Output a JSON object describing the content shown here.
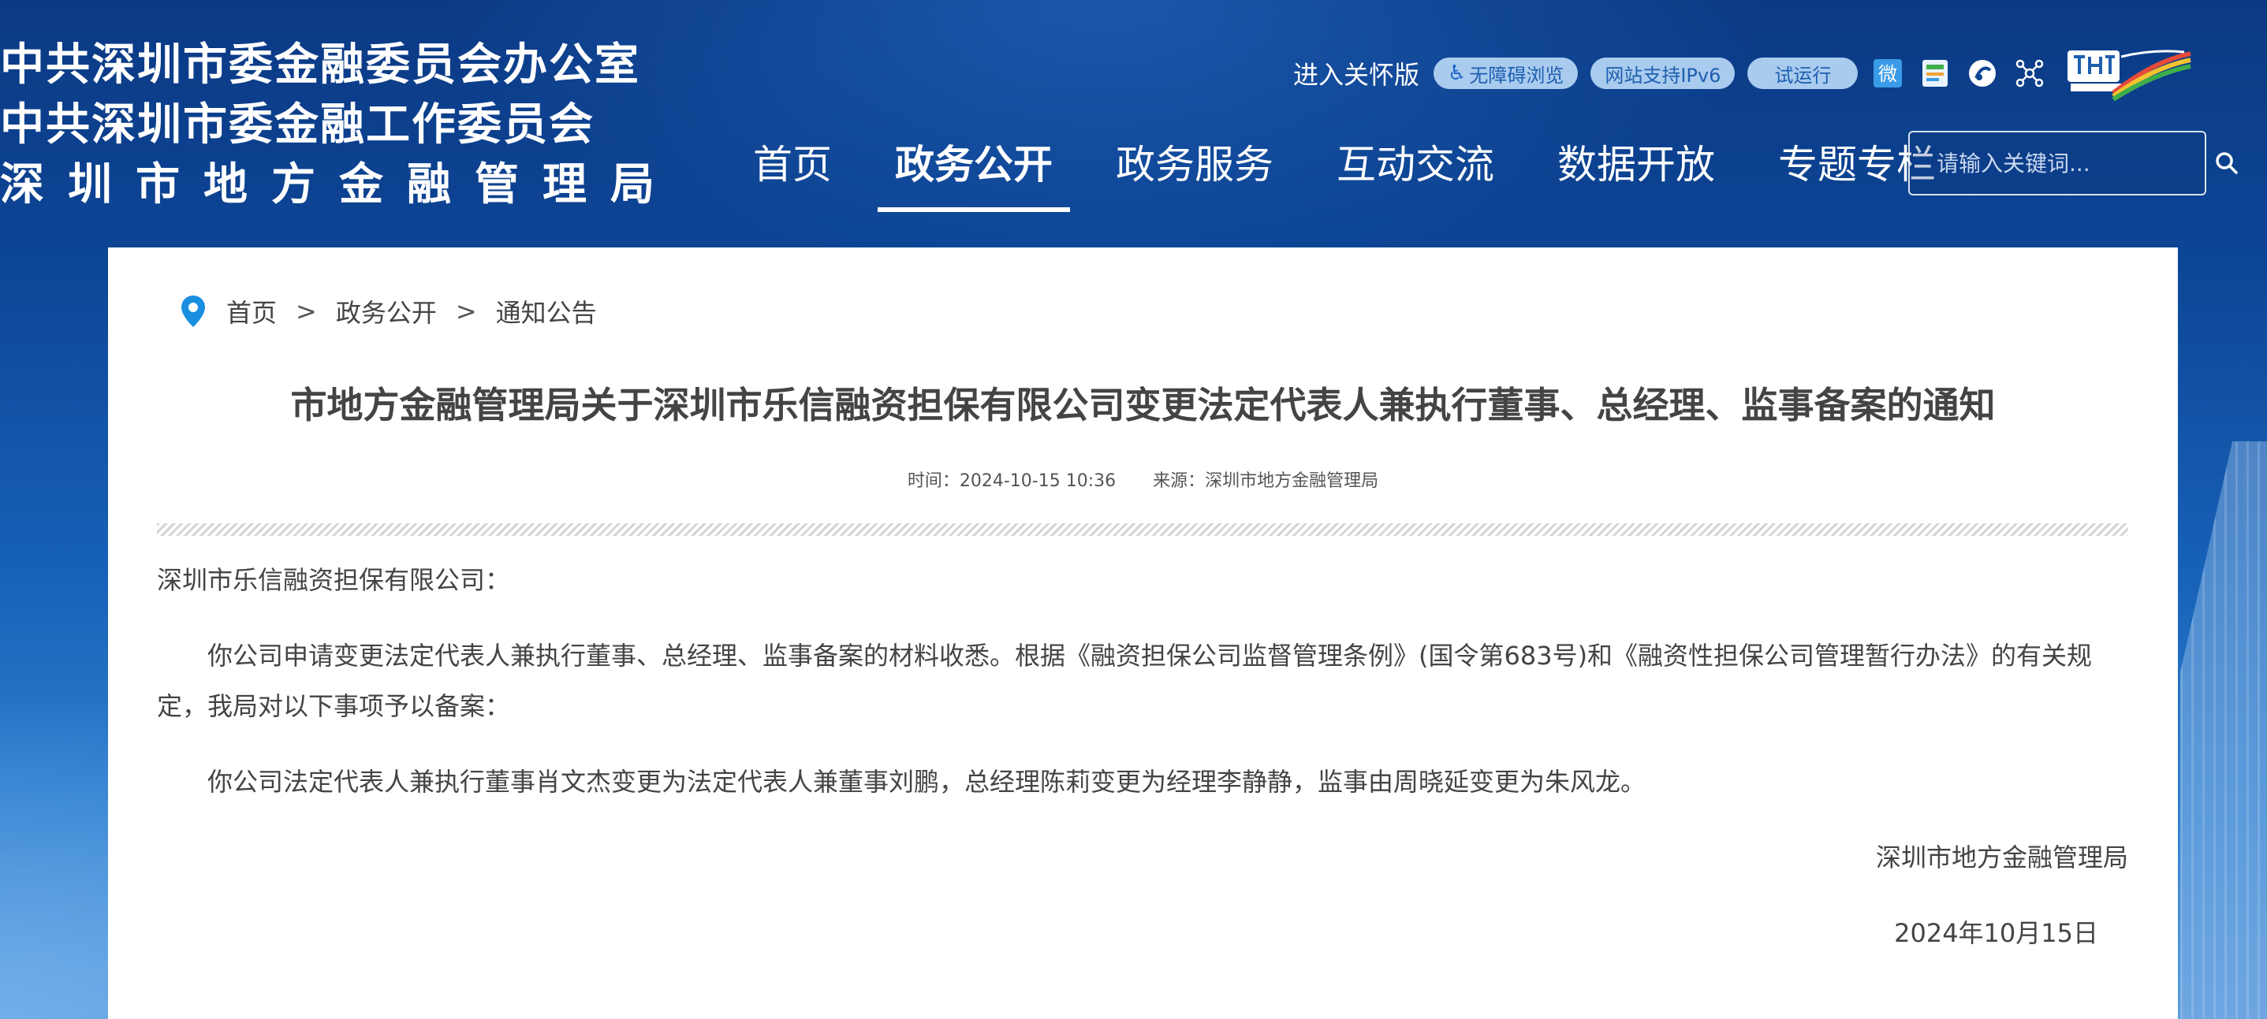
{
  "header": {
    "org_lines": [
      "中共深圳市委金融委员会办公室",
      "中共深圳市委金融工作委员会",
      "深圳市地方金融管理局"
    ],
    "utility": {
      "care_label": "进入关怀版",
      "accessibility_label": "无障碍浏览",
      "ipv6_label": "网站支持IPv6",
      "trial_label": "试运行"
    },
    "nav": [
      {
        "label": "首页",
        "active": false
      },
      {
        "label": "政务公开",
        "active": true
      },
      {
        "label": "政务服务",
        "active": false
      },
      {
        "label": "互动交流",
        "active": false
      },
      {
        "label": "数据开放",
        "active": false
      },
      {
        "label": "专题专栏",
        "active": false
      }
    ],
    "search": {
      "placeholder": "请输入关键词..."
    }
  },
  "breadcrumb": [
    "首页",
    "政务公开",
    "通知公告"
  ],
  "article": {
    "title": "市地方金融管理局关于深圳市乐信融资担保有限公司变更法定代表人兼执行董事、总经理、监事备案的通知",
    "time": "时间：2024-10-15 10:36",
    "source": "来源：深圳市地方金融管理局",
    "greeting": "深圳市乐信融资担保有限公司：",
    "paragraphs": [
      "你公司申请变更法定代表人兼执行董事、总经理、监事备案的材料收悉。根据《融资担保公司监督管理条例》(国令第683号)和《融资性担保公司管理暂行办法》的有关规定，我局对以下事项予以备案：",
      "你公司法定代表人兼执行董事肖文杰变更为法定代表人兼董事刘鹏，总经理陈莉变更为经理李静静，监事由周晓延变更为朱风龙。"
    ],
    "signature": "深圳市地方金融管理局",
    "date": "2024年10月15日"
  },
  "colors": {
    "header_bg": "#0d4595",
    "pill_bg": "#a9cbee",
    "panel_bg": "#ffffff",
    "text": "#444444",
    "pin": "#1a8fe0"
  }
}
